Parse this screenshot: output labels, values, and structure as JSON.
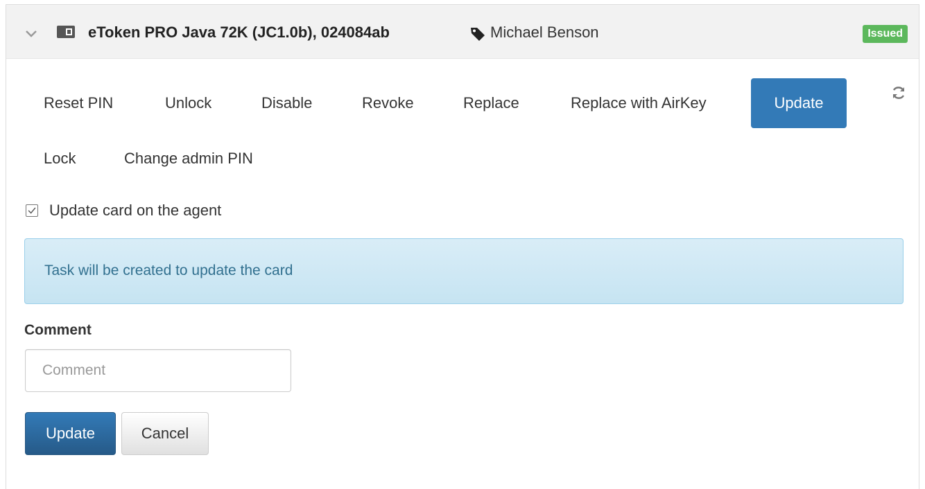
{
  "card": {
    "title": "eToken PRO Java 72K (JC1.0b), 024084ab",
    "owner": "Michael Benson",
    "status": "Issued",
    "status_color": "#5cb85c",
    "icons": {
      "expand": "chevron-down-icon",
      "card": "smart-card-icon",
      "owner": "tag-icon",
      "refresh": "refresh-icon"
    }
  },
  "actions": [
    {
      "label": "Reset PIN",
      "active": false
    },
    {
      "label": "Unlock",
      "active": false
    },
    {
      "label": "Disable",
      "active": false
    },
    {
      "label": "Revoke",
      "active": false
    },
    {
      "label": "Replace",
      "active": false
    },
    {
      "label": "Replace with AirKey",
      "active": false
    },
    {
      "label": "Update",
      "active": true
    },
    {
      "label": "Lock",
      "active": false
    },
    {
      "label": "Change admin PIN",
      "active": false
    }
  ],
  "form": {
    "update_on_agent_label": "Update card on the agent",
    "update_on_agent_checked": true,
    "info_message": "Task will be created to update the card",
    "comment_label": "Comment",
    "comment_placeholder": "Comment",
    "comment_value": "",
    "submit_label": "Update",
    "cancel_label": "Cancel"
  },
  "colors": {
    "primary": "#337ab7",
    "info_text": "#31708f",
    "info_bg": "#d9edf7"
  }
}
